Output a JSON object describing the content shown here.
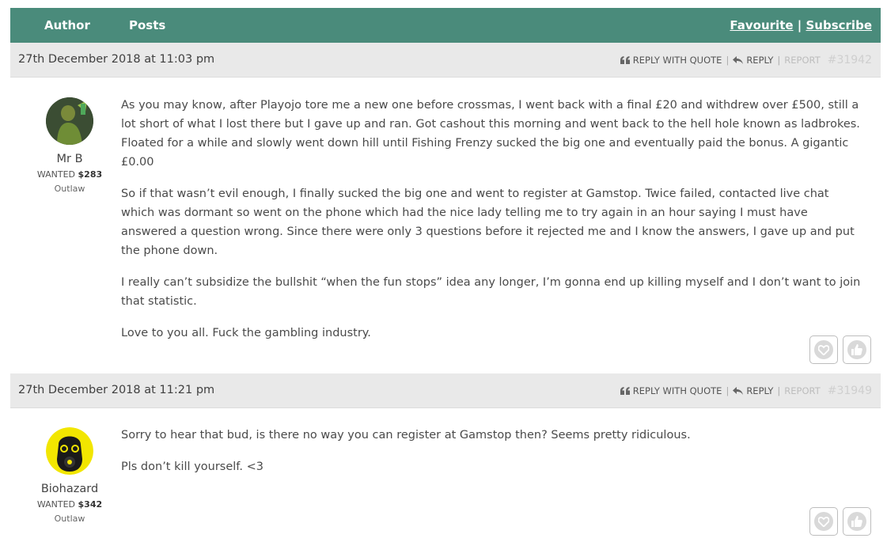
{
  "header": {
    "author_label": "Author",
    "posts_label": "Posts",
    "favourite_label": "Favourite",
    "divider": "|",
    "subscribe_label": "Subscribe"
  },
  "posts": [
    {
      "date": "27th December 2018 at 11:03 pm",
      "reply_quote_label": "REPLY WITH QUOTE",
      "reply_label": "REPLY",
      "report_label": "REPORT",
      "post_id": "#31942",
      "author": {
        "name": "Mr B",
        "wanted_label": "WANTED",
        "wanted_amount": "$283",
        "rank": "Outlaw"
      },
      "paragraphs": [
        "As you may know, after Playojo tore me a new one before crossmas, I went back with a final £20 and withdrew over £500, still a lot short of what I lost there but I gave up and ran. Got cashout this morning and went back to the hell hole known as ladbrokes. Floated for a while and slowly went down hill until Fishing Frenzy sucked the big one and eventually paid the bonus. A gigantic £0.00",
        "So if that wasn’t evil enough, I finally sucked the big one and went to register at Gamstop. Twice failed, contacted live chat which was dormant so went on the phone which had the nice lady telling me to try again in an hour saying I must have answered a question wrong. Since there were only 3 questions before it rejected me and I know the answers, I gave up and put the phone down.",
        "I really can’t subsidize the bullshit “when the fun stops” idea any longer, I’m gonna end up killing myself and I don’t want to join that statistic.",
        "Love to you all. Fuck the gambling industry."
      ]
    },
    {
      "date": "27th December 2018 at 11:21 pm",
      "reply_quote_label": "REPLY WITH QUOTE",
      "reply_label": "REPLY",
      "report_label": "REPORT",
      "post_id": "#31949",
      "author": {
        "name": "Biohazard",
        "wanted_label": "WANTED",
        "wanted_amount": "$342",
        "rank": "Outlaw"
      },
      "paragraphs": [
        "Sorry to hear that bud, is there no way you can register at Gamstop then? Seems pretty ridiculous.",
        "Pls don’t kill yourself. <3"
      ]
    }
  ],
  "colors": {
    "header_bg": "#4a8b7b",
    "post_head_bg": "#e9e9e9",
    "avatar2_bg": "#f2e600"
  },
  "icons": [
    "quote-icon",
    "reply-icon",
    "heart-icon",
    "thumbs-up-icon"
  ]
}
